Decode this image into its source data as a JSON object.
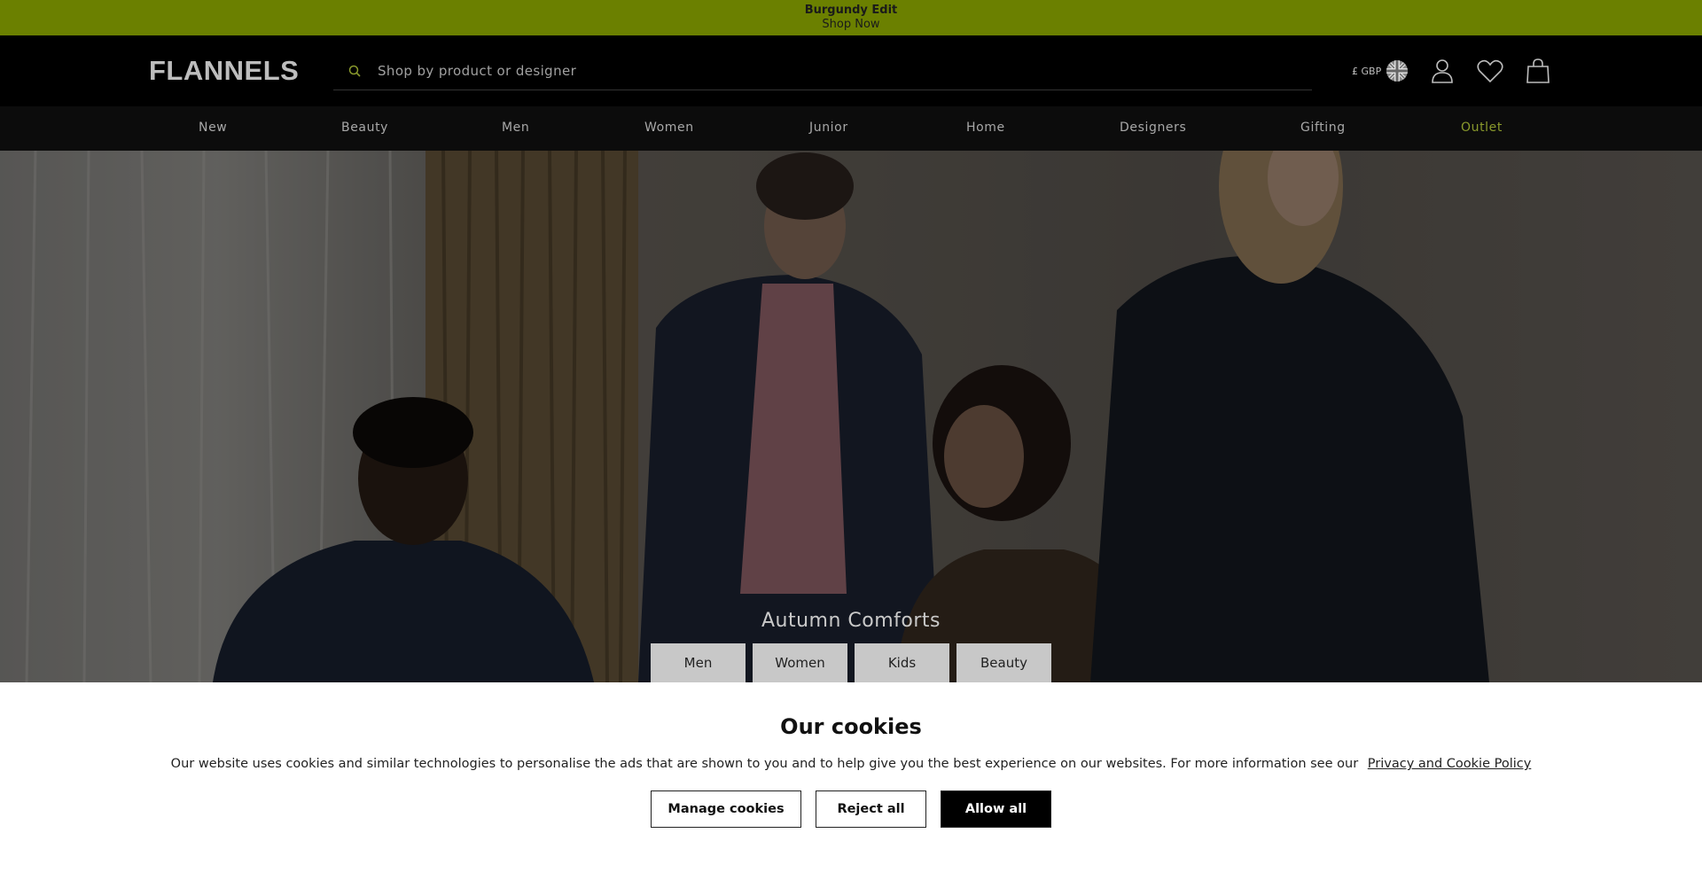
{
  "promo": {
    "title": "Burgundy Edit",
    "link": "Shop Now"
  },
  "header": {
    "logo": "FLANNELS",
    "search_placeholder": "Shop by product or designer",
    "currency": "£ GBP"
  },
  "nav": {
    "items": [
      "New",
      "Beauty",
      "Men",
      "Women",
      "Junior",
      "Home",
      "Designers",
      "Gifting",
      "Outlet"
    ]
  },
  "hero": {
    "title": "Autumn Comforts",
    "buttons": [
      "Men",
      "Women",
      "Kids",
      "Beauty"
    ]
  },
  "cookie": {
    "title": "Our cookies",
    "message": "Our website uses cookies and similar technologies to personalise the ads that are shown to you and to help give you the best experience on our websites. For more information see our",
    "policy_link": "Privacy and Cookie Policy",
    "manage": "Manage cookies",
    "reject": "Reject all",
    "allow": "Allow all"
  },
  "icons": [
    "search-icon",
    "uk-flag-icon",
    "account-icon",
    "wishlist-heart-icon",
    "shopping-bag-icon"
  ],
  "colors": {
    "promo_bg": "#6b8000",
    "outlet": "#8a9a2c",
    "header_bg": "#000000"
  }
}
